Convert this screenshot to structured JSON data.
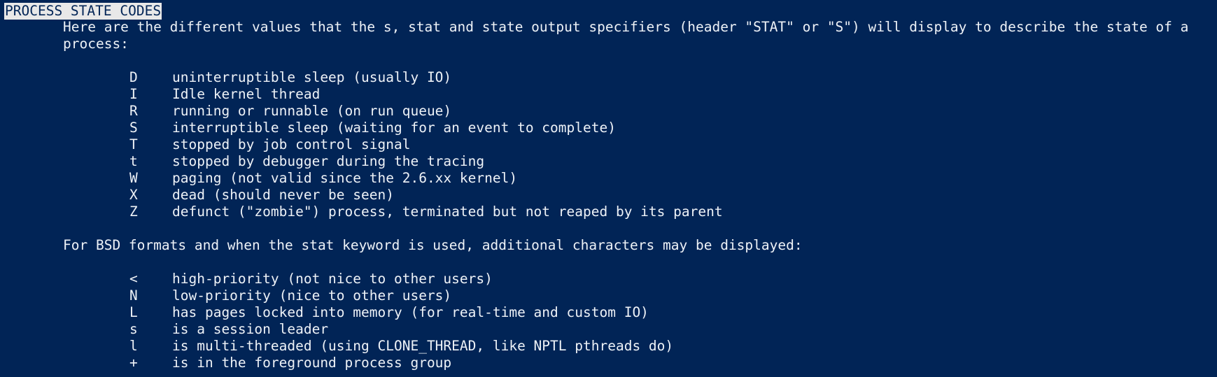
{
  "section_heading": "PROCESS STATE CODES",
  "intro": {
    "line1": "Here are the different values that the s, stat and state output specifiers (header \"STAT\" or \"S\") will display to describe the state of a",
    "line2": "process:"
  },
  "states": [
    {
      "code": "D",
      "desc": "uninterruptible sleep (usually IO)"
    },
    {
      "code": "I",
      "desc": "Idle kernel thread"
    },
    {
      "code": "R",
      "desc": "running or runnable (on run queue)"
    },
    {
      "code": "S",
      "desc": "interruptible sleep (waiting for an event to complete)"
    },
    {
      "code": "T",
      "desc": "stopped by job control signal"
    },
    {
      "code": "t",
      "desc": "stopped by debugger during the tracing"
    },
    {
      "code": "W",
      "desc": "paging (not valid since the 2.6.xx kernel)"
    },
    {
      "code": "X",
      "desc": "dead (should never be seen)"
    },
    {
      "code": "Z",
      "desc": "defunct (\"zombie\") process, terminated but not reaped by its parent"
    }
  ],
  "bsd_intro": "For BSD formats and when the stat keyword is used, additional characters may be displayed:",
  "bsd_states": [
    {
      "code": "<",
      "desc": "high-priority (not nice to other users)"
    },
    {
      "code": "N",
      "desc": "low-priority (nice to other users)"
    },
    {
      "code": "L",
      "desc": "has pages locked into memory (for real-time and custom IO)"
    },
    {
      "code": "s",
      "desc": "is a session leader"
    },
    {
      "code": "l",
      "desc": "is multi-threaded (using CLONE_THREAD, like NPTL pthreads do)"
    },
    {
      "code": "+",
      "desc": "is in the foreground process group"
    }
  ],
  "colors": {
    "background": "#012456",
    "foreground": "#eef2f7",
    "highlight_bg": "#e8e8e8"
  }
}
